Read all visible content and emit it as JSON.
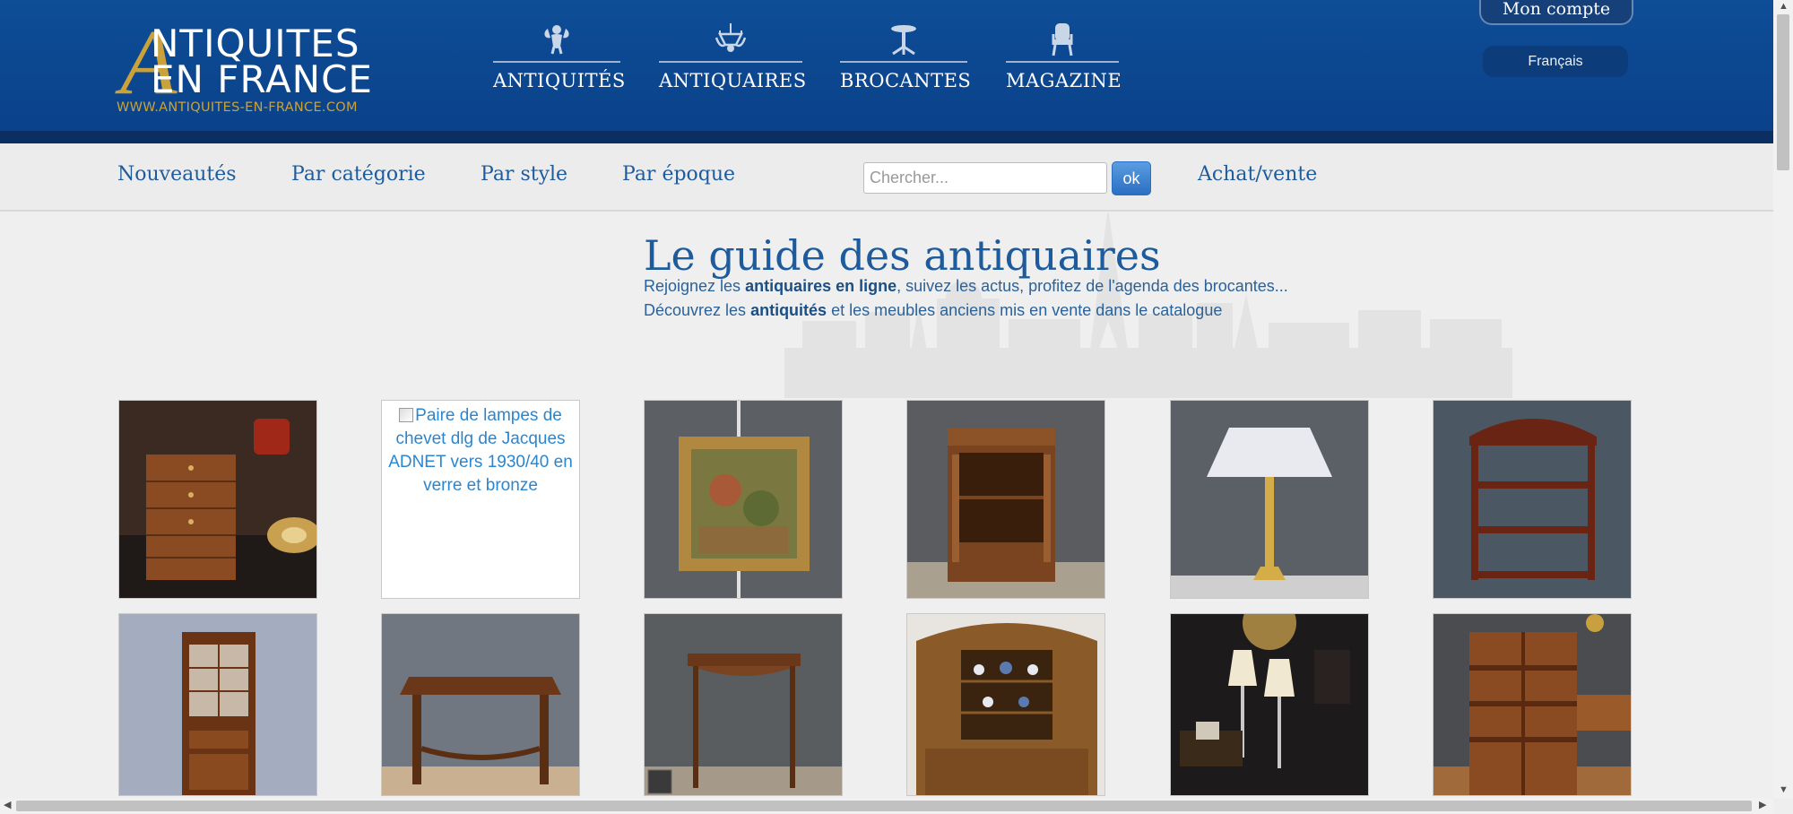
{
  "header": {
    "logo": {
      "line1": "NTIQUITES",
      "big_letter": "A",
      "line2": "EN FRANCE",
      "url": "WWW.ANTIQUITES-EN-FRANCE.COM"
    },
    "nav": [
      {
        "label": "ANTIQUITÉS",
        "icon": "cherub-icon"
      },
      {
        "label": "ANTIQUAIRES",
        "icon": "chandelier-icon"
      },
      {
        "label": "BROCANTES",
        "icon": "pedestal-table-icon"
      },
      {
        "label": "MAGAZINE",
        "icon": "armchair-icon"
      }
    ],
    "account_label": "Mon compte",
    "language": "Français"
  },
  "subnav": {
    "links": [
      "Nouveautés",
      "Par catégorie",
      "Par style",
      "Par époque"
    ],
    "search_placeholder": "Chercher...",
    "search_button": "ok",
    "achat_vente": "Achat/vente"
  },
  "intro": {
    "title": "Le guide des antiquaires",
    "line1": {
      "before": "Rejoignez les ",
      "bold": "antiquaires en ligne",
      "after": ", suivez les actus, profitez de l'agenda des brocantes..."
    },
    "line2": {
      "before": "Découvrez les ",
      "bold": "antiquités",
      "after": " et les meubles anciens mis en vente dans le catalogue"
    }
  },
  "products": {
    "broken_alt": "Paire de lampes de chevet dlg de Jacques ADNET vers 1930/40 en verre et bronze",
    "row1": [
      "wooden-chest-of-drawers-photo",
      "broken-image",
      "framed-painting-photo",
      "bedside-cabinet-photo",
      "brass-table-lamp-photo",
      "wall-shelf-photo"
    ],
    "row2": [
      "display-cabinet-photo",
      "square-table-photo",
      "console-table-photo",
      "carved-buffet-photo",
      "pair-of-lamps-photo",
      "revolving-bookcase-photo"
    ]
  }
}
